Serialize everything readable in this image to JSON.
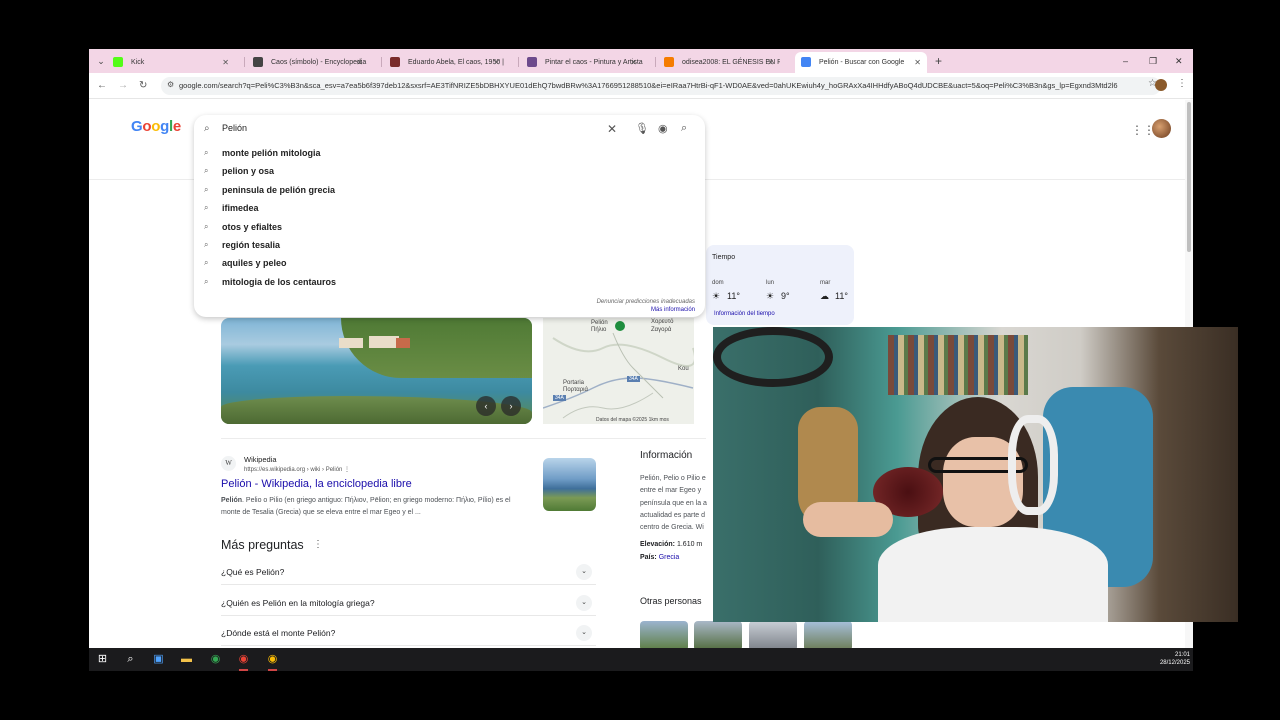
{
  "browser": {
    "tabs": [
      {
        "title": "Kick",
        "color": "#53fc18"
      },
      {
        "title": "Caos (símbolo) - Encyclopedia",
        "color": "#444444"
      },
      {
        "title": "Eduardo Abela, El caos, 1950 | M",
        "color": "#7a2b2b"
      },
      {
        "title": "Pintar el caos - Pintura y Artista",
        "color": "#6d4a8c"
      },
      {
        "title": "odisea2008: EL GÉNESIS EN RO",
        "color": "#f57c00"
      },
      {
        "title": "Pelión - Buscar con Google",
        "color": "#4285f4"
      }
    ],
    "new_tab_icon": "+",
    "window_controls": [
      "–",
      "❐",
      "✕"
    ],
    "url": "google.com/search?q=Peli%C3%B3n&sca_esv=a7ea5b6f397deb12&sxsrf=AE3TifNRIZE5bDBHXYUE01dEhQ7bwdBRw%3A1766951288510&ei=eIRaa7HtrBi-qF1-WD0AE&ved=0ahUKEwiuh4y_hoGRAxXa4IHHdfyABoQ4dUDCBE&uact=5&oq=Peli%C3%B3n&gs_lp=Egxnd3Mtd2l6"
  },
  "search": {
    "query": "Pelión",
    "logo_letters": [
      {
        "ch": "G",
        "color": "#4285f4"
      },
      {
        "ch": "o",
        "color": "#ea4335"
      },
      {
        "ch": "o",
        "color": "#fbbc05"
      },
      {
        "ch": "g",
        "color": "#4285f4"
      },
      {
        "ch": "l",
        "color": "#34a853"
      },
      {
        "ch": "e",
        "color": "#ea4335"
      }
    ],
    "suggestions": [
      "monte pelión mitologia",
      "pelion y osa",
      "peninsula de pelión grecia",
      "ifimedea",
      "otos y efialtes",
      "región tesalia",
      "aquiles y peleo",
      "mitologia de los centauros"
    ],
    "report_text": "Denunciar predicciones inadecuadas",
    "more_info": "Más información"
  },
  "weather": {
    "title": "Tiempo",
    "days": [
      {
        "day": "dom",
        "temp": "11°",
        "icon": "☀"
      },
      {
        "day": "lun",
        "temp": "9°",
        "icon": "☀"
      },
      {
        "day": "mar",
        "temp": "11°",
        "icon": "☁"
      }
    ],
    "link": "Información del tiempo"
  },
  "map": {
    "label_top": "Pelión\nΠήλιο",
    "label_zag": "Ζαγορά",
    "label_k": "Χορευτό",
    "label_port": "Portaria\nΠορταριά",
    "road1": "34A",
    "road2": "34A",
    "footer": "Datos del mapa ©2025   1km mos",
    "kou": "Kou"
  },
  "result": {
    "site": "Wikipedia",
    "url": "https://es.wikipedia.org › wiki › Pelión",
    "title": "Pelión - Wikipedia, la enciclopedia libre",
    "snippet_bold": "Pelión",
    "snippet": ". Pelio o Pilio (en griego antiguo: Πήλιον, Pēlion; en griego moderno: Πήλιο, Pílio) es el monte de Tesalia (Grecia) que se eleva entre el mar Egeo y el ..."
  },
  "more_questions": {
    "title": "Más preguntas",
    "items": [
      "¿Qué es Pelión?",
      "¿Quién es Pelión en la mitología griega?",
      "¿Dónde está el monte Pelión?"
    ]
  },
  "info_panel": {
    "title": "Información",
    "text": "Pelión, Pelio o Pilio e entre el mar Egeo y península que en la a actualidad es parte d centro de Grecia. Wi",
    "elev_label": "Elevación:",
    "elev_value": "1.610 m",
    "country_label": "País:",
    "country_value": "Grecia",
    "others": "Otras personas"
  },
  "taskbar": {
    "time": "21:01",
    "date": "28/12/2025"
  }
}
